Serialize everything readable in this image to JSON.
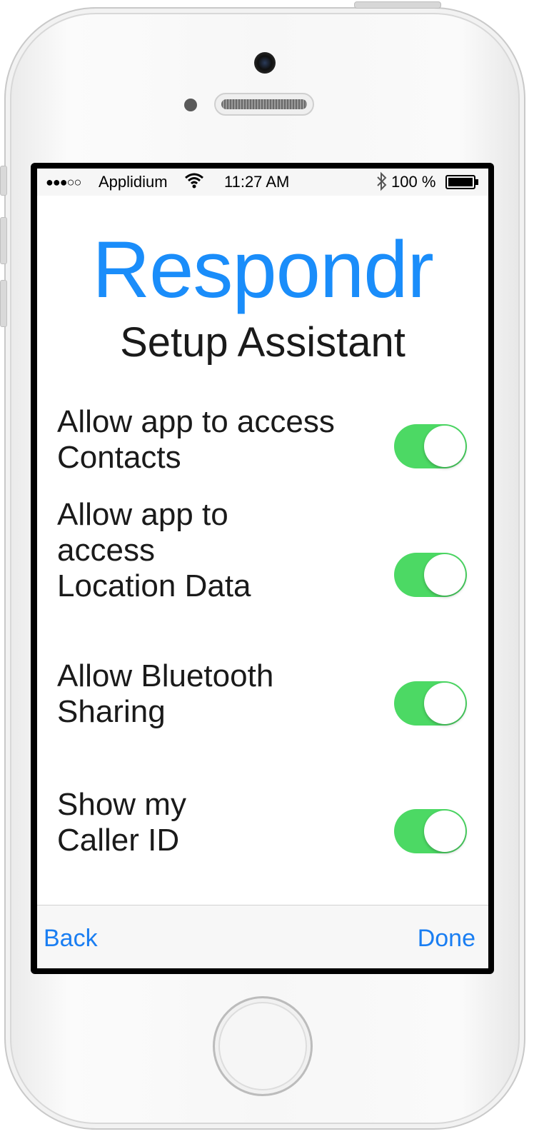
{
  "status_bar": {
    "signal_dots": "●●●○○",
    "carrier": "Applidium",
    "time": "11:27 AM",
    "battery_percent": "100 %"
  },
  "header": {
    "app_name": "Respondr",
    "subtitle": "Setup Assistant"
  },
  "settings": [
    {
      "label": "Allow app to access Contacts",
      "on": true
    },
    {
      "label": "Allow app to access Location Data",
      "on": true
    },
    {
      "label": "Allow Bluetooth Sharing",
      "on": true
    },
    {
      "label": "Show my Caller ID",
      "on": true
    }
  ],
  "toolbar": {
    "back_label": "Back",
    "done_label": "Done"
  },
  "colors": {
    "accent": "#1a8dfa",
    "toggle_on": "#4cd964"
  }
}
